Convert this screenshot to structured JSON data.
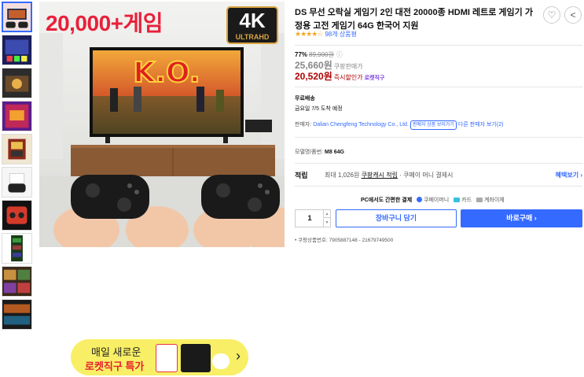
{
  "gallery": {
    "hero_title": "20,000+게임",
    "badge_main": "4K",
    "badge_sub": "ULTRAHD",
    "tv_text": "K.O.",
    "thumbnail_count": 10
  },
  "banner": {
    "line1": "매일 새로운",
    "line2": "로켓직구 특가",
    "chevron": "›"
  },
  "product": {
    "title": "DS 무선 오락실 게임기 2인 대전 20000종 HDMI 레트로 게임기 가정용 고전 게임기 64G 한국어 지원",
    "favorite_icon": "♡",
    "share_icon": "<",
    "stars": "★★★★☆",
    "rating_count": "98개 상품평",
    "rating_value": 4.5
  },
  "price": {
    "discount_pct": "77%",
    "original": "89,900원",
    "info_icon": "ⓘ",
    "coupang_price": "25,660원",
    "coupang_label": "쿠팡판매가",
    "sale_price": "20,520원",
    "sale_label": "즉시할인가",
    "rocket_label": "로켓직구"
  },
  "shipping": {
    "title": "무료배송",
    "eta": "금요일 7/5 도착 예정"
  },
  "seller": {
    "label": "판매자:",
    "name": "Dalian Chengfeng Technology Co., Ltd.",
    "pill": "판매자 상품 보러가기",
    "other": "다른 판매자 보기(2)"
  },
  "model": {
    "label": "모델명/품번:",
    "value": "M8 64G"
  },
  "cash": {
    "label": "적립",
    "desc_prefix": "최대 1,026원",
    "desc_link": "쿠팡캐시 적립",
    "desc_suffix": "· 쿠페이 머니 결제시",
    "benefit": "혜택보기 ›"
  },
  "payment": {
    "label": "PC에서도 간편한 결제",
    "coupay": "쿠페이머니",
    "card": "카드",
    "bank": "계좌이체"
  },
  "purchase": {
    "qty": "1",
    "up": "▲",
    "down": "▼",
    "cart": "장바구니 담기",
    "buy": "바로구매 ›"
  },
  "product_code": "쿠팡상품번호: 7905887148 - 21679749500"
}
